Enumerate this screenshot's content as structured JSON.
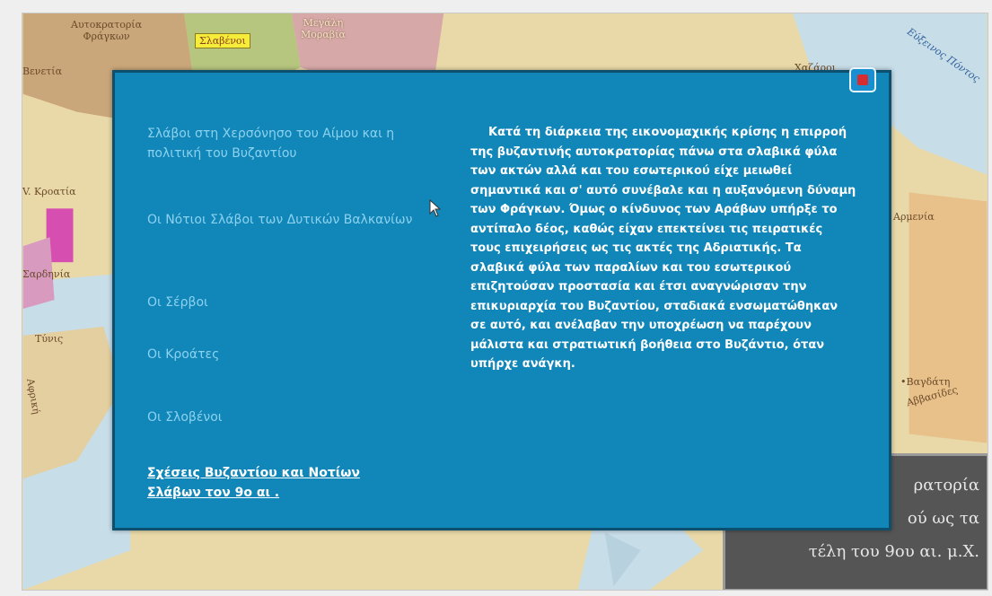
{
  "map": {
    "labels": {
      "frankish": "Αυτοκρατορία\nΦράγκων",
      "slavs": "Σλαβένοι",
      "moravia": "Μεγάλη\nΜοραβία",
      "black_sea": "Εύξεινος Πόντος",
      "venice_left": "Βενετία",
      "v_kroatia": "V. Κροατία",
      "sardinia": "Σαρδηνία",
      "tunis": "Τύνις",
      "africa": "Αφρική",
      "right_top": "Χαζάροι",
      "right_mid": "Αρμενία",
      "right_low": "•Βαγδάτη",
      "right_low2": "Αββασίδες"
    },
    "colors": {
      "land": "#e9d9a8",
      "frankish": "#c9a77a",
      "slavs": "#b6c67e",
      "moravia": "#d7a8a8",
      "pink": "#d64fb0",
      "sea": "#c7dde8",
      "byzantine": "#e8c08a"
    }
  },
  "title_panel": {
    "lines": [
      "ρατορία",
      "ού ως τα",
      "τέλη του 9ου αι. μ.Χ."
    ]
  },
  "modal": {
    "close_label": "✕",
    "menu": [
      "Σλάβοι στη Χερσόνησο του Αίμου και η πολιτική του Βυζαντίου",
      "Οι Νότιοι Σλάβοι των Δυτικών Βαλκανίων",
      "Οι Σέρβοι",
      "Οι Κροάτες",
      "Οι Σλοβένοι"
    ],
    "active_link": "Σχέσεις Βυζαντίου και Νοτίων Σλάβων τον 9ο αι .",
    "body": "Κατά τη διάρκεια της εικονομαχικής κρίσης η επιρροή της βυζαντινής αυτοκρατορίας πάνω στα σλαβικά φύλα των ακτών αλλά και του εσωτερικού είχε μειωθεί σημαντικά και σ' αυτό συνέβαλε και η αυξανόμενη δύναμη των Φράγκων. Όμως ο κίνδυνος των Αράβων υπήρξε το αντίπαλο δέος, καθώς είχαν επεκτείνει τις πειρατικές τους επιχειρήσεις ως τις ακτές της Αδριατικής. Τα σλαβικά φύλα των παραλίων και του εσωτερικού επιζητούσαν προστασία και έτσι αναγνώρισαν την επικυριαρχία του Βυζαντίου, σταδιακά ενσωματώθηκαν σε αυτό, και ανέλαβαν την υποχρέωση να παρέχουν μάλιστα και στρατιωτική βοήθεια στο Βυζάντιο, όταν υπήρχε ανάγκη."
  }
}
